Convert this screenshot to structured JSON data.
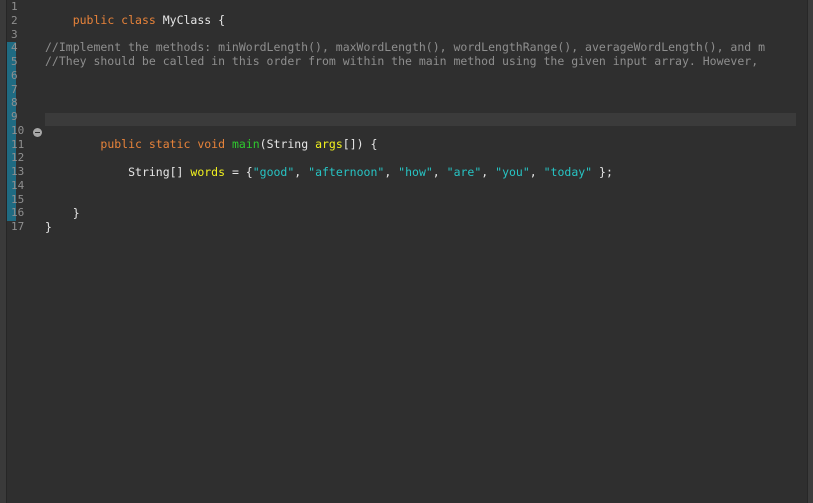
{
  "line_numbers": [
    "1",
    "2",
    "3",
    "4",
    "5",
    "6",
    "7",
    "8",
    "9",
    "10",
    "11",
    "12",
    "13",
    "14",
    "15",
    "16",
    "17"
  ],
  "code": {
    "l1": {
      "kw": "public class ",
      "name": "MyClass",
      "brace": " {"
    },
    "l4": "//Implement the methods: minWordLength(), maxWordLength(), wordLengthRange(), averageWordLength(), and m",
    "l5": "//They should be called in this order from within the main method using the given input array. However,",
    "l10": {
      "indent": "    ",
      "kw": "public static void ",
      "method": "main",
      "open": "(String ",
      "arg": "args",
      "close": "[]) {"
    },
    "l12": {
      "indent": "        ",
      "type": "String[] ",
      "var": "words",
      "assign": " = {",
      "strings": [
        "\"good\"",
        "\"afternoon\"",
        "\"how\"",
        "\"are\"",
        "\"you\"",
        "\"today\""
      ],
      "sep": ", ",
      "end": " };"
    },
    "l16": "    }",
    "l17": "}"
  },
  "colors": {
    "background": "#2f2f2f",
    "keyword": "#e8833a",
    "comment": "#8e8e8e",
    "method": "#2ec92e",
    "variable": "#f2f21f",
    "string": "#27c4c4",
    "change_bar": "#1f6b82"
  },
  "icons": {
    "fold": "collapse-icon"
  }
}
